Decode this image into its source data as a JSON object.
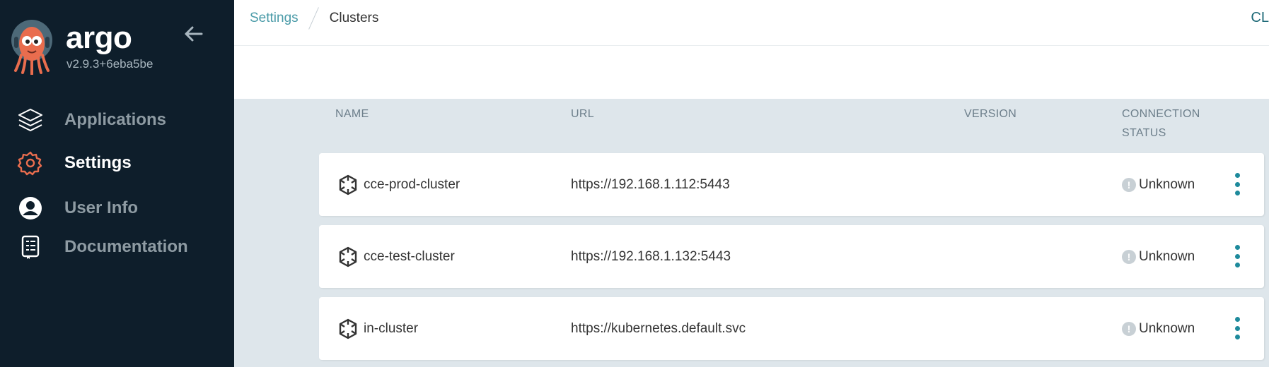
{
  "brand": {
    "name": "argo",
    "version": "v2.9.3+6eba5be",
    "logo_icon": "argo-octopus-logo"
  },
  "sidebar": {
    "collapse_icon": "arrow-left-icon",
    "items": [
      {
        "label": "Applications",
        "icon": "layers-icon",
        "active": false
      },
      {
        "label": "Settings",
        "icon": "gear-icon",
        "active": true
      },
      {
        "label": "User Info",
        "icon": "user-circle-icon",
        "active": false
      },
      {
        "label": "Documentation",
        "icon": "book-icon",
        "active": false
      }
    ]
  },
  "breadcrumb": {
    "parent": "Settings",
    "current": "Clusters"
  },
  "topbar": {
    "right_text": "CL"
  },
  "table": {
    "headers": {
      "name": "NAME",
      "url": "URL",
      "version": "VERSION",
      "status_line1": "CONNECTION",
      "status_line2": "STATUS"
    },
    "rows": [
      {
        "name": "cce-prod-cluster",
        "url": "https://192.168.1.112:5443",
        "version": "",
        "status": "Unknown"
      },
      {
        "name": "cce-test-cluster",
        "url": "https://192.168.1.132:5443",
        "version": "",
        "status": "Unknown"
      },
      {
        "name": "in-cluster",
        "url": "https://kubernetes.default.svc",
        "version": "",
        "status": "Unknown"
      }
    ]
  },
  "colors": {
    "sidebar_bg": "#0e1e2b",
    "accent": "#1e8a9c",
    "settings_icon": "#e96d4e",
    "status_unknown": "#c8d0d5",
    "content_bg": "#dee6eb"
  }
}
